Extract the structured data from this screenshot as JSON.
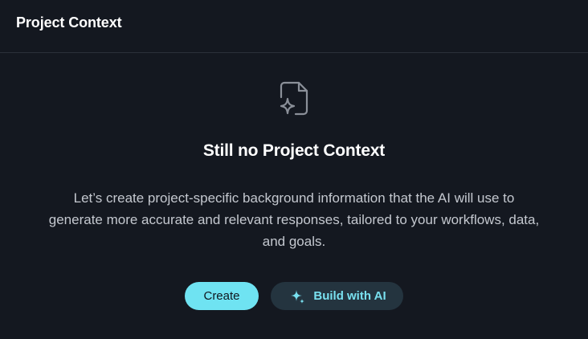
{
  "header": {
    "title": "Project Context"
  },
  "empty_state": {
    "icon": "file-sparkle-icon",
    "title": "Still no Project Context",
    "description": "Let’s create project-specific background information that the AI will use to generate more accurate and relevant responses, tailored to your workflows, data, and goals."
  },
  "actions": {
    "create_label": "Create",
    "build_ai_label": "Build with AI",
    "build_ai_icon": "sparkle-icon"
  },
  "colors": {
    "background": "#141820",
    "accent": "#6fe3f2",
    "ai_button_bg": "#24343f",
    "ai_button_text": "#79e1f0"
  }
}
